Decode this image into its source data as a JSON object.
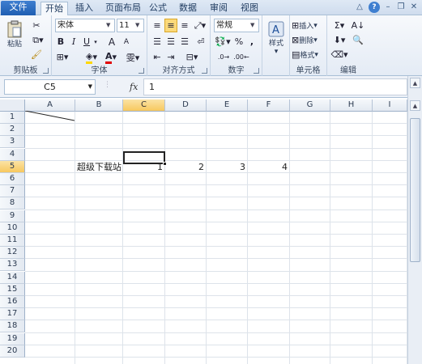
{
  "tabs": {
    "file": "文件",
    "home": "开始",
    "insert": "插入",
    "layout": "页面布局",
    "formulas": "公式",
    "data": "数据",
    "review": "审阅",
    "view": "视图"
  },
  "ribbon": {
    "clipboard": {
      "label": "剪贴板",
      "paste": "粘贴"
    },
    "font": {
      "label": "字体",
      "font_name": "宋体",
      "font_size": "11",
      "bold": "B",
      "italic": "I",
      "underline": "U",
      "grow": "A",
      "shrink": "A"
    },
    "alignment": {
      "label": "对齐方式"
    },
    "number": {
      "label": "数字",
      "format": "常规",
      "percent": "%",
      "comma": ","
    },
    "styles": {
      "label": "样式"
    },
    "cells": {
      "label": "单元格",
      "insert": "插入",
      "delete": "删除",
      "format": "格式"
    },
    "editing": {
      "label": "编辑"
    }
  },
  "formula_bar": {
    "name_box": "C5",
    "fx": "fx",
    "value": "1"
  },
  "columns": [
    "A",
    "B",
    "C",
    "D",
    "E",
    "F",
    "G",
    "H",
    "I"
  ],
  "rows": [
    "1",
    "2",
    "3",
    "4",
    "5",
    "6",
    "7",
    "8",
    "9",
    "10",
    "11",
    "12",
    "13",
    "14",
    "15",
    "16",
    "17",
    "18",
    "19",
    "20"
  ],
  "cells": {
    "B5": "超级下载站",
    "C5": "1",
    "D5": "2",
    "E5": "3",
    "F5": "4"
  },
  "selected_cell": "C5"
}
